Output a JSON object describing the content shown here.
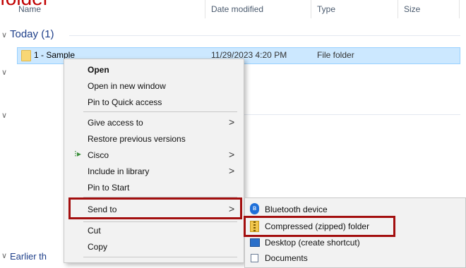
{
  "caption": "folder",
  "columns": {
    "name": "Name",
    "date": "Date modified",
    "type": "Type",
    "size": "Size"
  },
  "group": {
    "today": "Today (1)",
    "earlier": "Earlier th"
  },
  "row": {
    "name": "1 - Sample",
    "date": "11/29/2023 4:20 PM",
    "type": "File folder"
  },
  "context_menu": {
    "open": "Open",
    "open_new_window": "Open in new window",
    "pin_quick_access": "Pin to Quick access",
    "give_access": "Give access to",
    "restore_versions": "Restore previous versions",
    "cisco": "Cisco",
    "include_library": "Include in library",
    "pin_start": "Pin to Start",
    "send_to": "Send to",
    "cut": "Cut",
    "copy": "Copy"
  },
  "send_to_menu": {
    "bluetooth": "Bluetooth device",
    "compressed": "Compressed (zipped) folder",
    "desktop": "Desktop (create shortcut)",
    "documents": "Documents"
  },
  "colors": {
    "highlight_border": "#a30f0f",
    "selection": "#cce8ff",
    "caption": "#c00000"
  }
}
